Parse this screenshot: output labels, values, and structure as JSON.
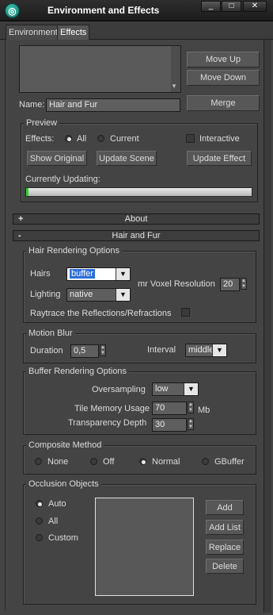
{
  "window": {
    "title": "Environment and Effects",
    "minimize": "_",
    "maximize": "□",
    "close": "✕",
    "app_icon": "3ds-max-icon"
  },
  "tabs": [
    {
      "label": "Environment"
    },
    {
      "label": "Effects"
    }
  ],
  "effects": {
    "move_up": "Move Up",
    "move_down": "Move Down",
    "name_label": "Name:",
    "name_value": "Hair and Fur",
    "merge": "Merge"
  },
  "preview": {
    "title": "Preview",
    "effects_label": "Effects:",
    "all": "All",
    "current": "Current",
    "interactive": "Interactive",
    "show_original": "Show Original",
    "update_scene": "Update Scene",
    "update_effect": "Update Effect",
    "currently_updating": "Currently Updating:"
  },
  "rollouts": {
    "about": {
      "sign": "+",
      "title": "About"
    },
    "hair": {
      "sign": "-",
      "title": "Hair and Fur"
    }
  },
  "hair_rendering": {
    "title": "Hair Rendering Options",
    "hairs_label": "Hairs",
    "hairs_value": "buffer",
    "lighting_label": "Lighting",
    "lighting_value": "native",
    "voxel_label": "mr Voxel Resolution",
    "voxel_value": "20",
    "raytrace_label": "Raytrace the Reflections/Refractions"
  },
  "motion_blur": {
    "title": "Motion Blur",
    "duration_label": "Duration",
    "duration_value": "0,5",
    "interval_label": "Interval",
    "interval_value": "middle"
  },
  "buffer_rendering": {
    "title": "Buffer Rendering Options",
    "oversampling_label": "Oversampling",
    "oversampling_value": "low",
    "tile_memory_label": "Tile Memory Usage",
    "tile_memory_value": "70",
    "tile_memory_unit": "Mb",
    "transparency_label": "Transparency Depth",
    "transparency_value": "30"
  },
  "composite": {
    "title": "Composite Method",
    "options": [
      "None",
      "Off",
      "Normal",
      "GBuffer"
    ],
    "selected": "Normal"
  },
  "occlusion": {
    "title": "Occlusion Objects",
    "options": [
      "Auto",
      "All",
      "Custom"
    ],
    "selected": "Auto",
    "add": "Add",
    "add_list": "Add List",
    "replace": "Replace",
    "delete": "Delete"
  },
  "colors": {
    "panel_bg": "#444444",
    "progress_fill": "#2bd42b",
    "selection": "#2f6fd8"
  }
}
